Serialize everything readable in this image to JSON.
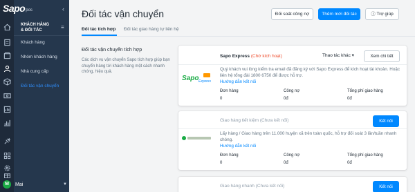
{
  "app": {
    "logo_main": "Sapo",
    "logo_sub": "pos"
  },
  "sidebar": {
    "section_title_line1": "KHÁCH HÀNG",
    "section_title_line2": "& ĐỐI TÁC",
    "menu_glyph": "≡",
    "items": [
      {
        "label": "Khách hàng"
      },
      {
        "label": "Nhóm khách hàng"
      },
      {
        "label": "Nhà cung cấp"
      },
      {
        "label": "Đối tác vận chuyển"
      }
    ],
    "user": {
      "initial": "M",
      "name": "Mai"
    }
  },
  "header": {
    "title": "Đối tác vận chuyển",
    "buttons": {
      "reconcile": "Đối soát công nợ",
      "add_partner": "Thêm mới đối tác",
      "help": "Trợ giúp"
    }
  },
  "tabs": [
    {
      "label": "Đối tác tích hợp"
    },
    {
      "label": "Đối tác giao hàng tự liên hệ"
    }
  ],
  "section": {
    "title": "Đối tác vận chuyển tích hợp",
    "description": "Các dịch vụ vận chuyển Sapo tích hợp giúp bạn chuyển hàng tới khách hàng một cách nhanh chóng, hiệu quả."
  },
  "partners": [
    {
      "name": "Sapo Express",
      "status": "(Chờ kích hoạt)",
      "actions_label": "Thao tác khác",
      "button": "Xem chi tiết",
      "description": "Quý khách vui lòng kiểm tra email đã đăng ký với Sapo Express để kích hoạt tài khoản. Hoặc liên hệ tổng đài 1800 6750 để được hỗ trợ.",
      "link": "Hướng dẫn kết nối",
      "stats": [
        {
          "label": "Đơn hàng",
          "value": "0"
        },
        {
          "label": "Công nợ",
          "value": "0đ"
        },
        {
          "label": "Tổng phí giao hàng",
          "value": "0đ"
        }
      ]
    },
    {
      "name": "Giao hàng tiết kiệm",
      "status": "(Chưa kết nối)",
      "button": "Kết nối",
      "description": "Lấy hàng / Giao hàng trên 11.000 huyện xã trên toàn quốc, hỗ trợ đối soát 3 lần/tuần nhanh chóng.",
      "link": "Hướng dẫn kết nối",
      "stats": [
        {
          "label": "Đơn hàng",
          "value": "0"
        },
        {
          "label": "Công nợ",
          "value": "0đ"
        },
        {
          "label": "Tổng phí giao hàng",
          "value": "0đ"
        }
      ]
    },
    {
      "name": "Giao hàng nhanh",
      "status": "(Chưa kết nối)",
      "button": "Kết nối"
    }
  ],
  "colors": {
    "primary": "#0088ff",
    "sidebar": "#25374d",
    "rail": "#1e2a3a",
    "danger": "#ee4d2d",
    "active_item": "#2f8dfa"
  },
  "icons": [
    "home-icon",
    "order-icon",
    "box-icon",
    "person-icon",
    "cube-icon",
    "money-icon",
    "report-icon",
    "chart-icon",
    "plug-icon",
    "apps-icon",
    "settings-icon",
    "gift-icon"
  ]
}
